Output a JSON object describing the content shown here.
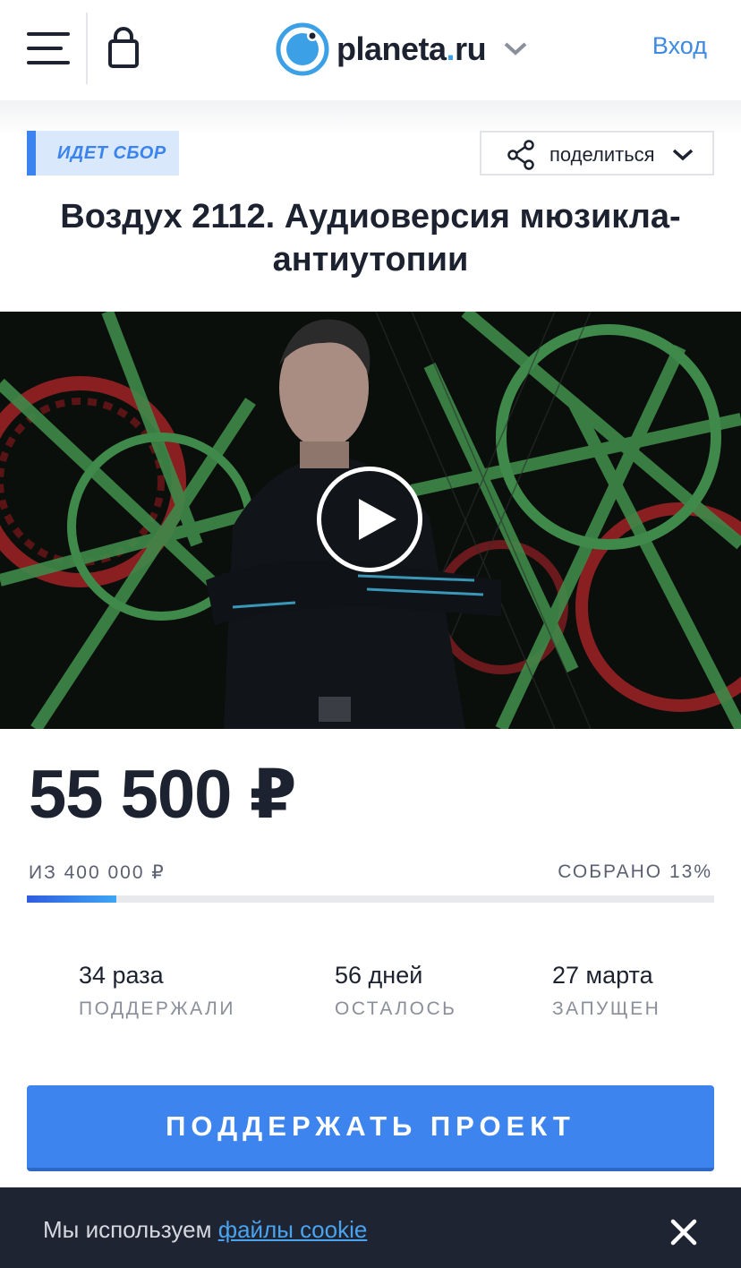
{
  "header": {
    "logo_text_main": "planeta",
    "logo_text_dot": ".",
    "logo_text_tld": "ru",
    "login_label": "Вход"
  },
  "project": {
    "status": "ИДЕТ СБОР",
    "share_label": "поделиться",
    "title": "Воздух 2112. Аудиоверсия мюзикла-антиутопии"
  },
  "funding": {
    "amount": "55 500 ₽",
    "goal": "ИЗ 400 000 ₽",
    "collected": "СОБРАНО 13%",
    "progress_percent": 13
  },
  "stats": [
    {
      "value": "34 раза",
      "caption": "ПОДДЕРЖАЛИ"
    },
    {
      "value": "56 дней",
      "caption": "ОСТАЛОСЬ"
    },
    {
      "value": "27 марта",
      "caption": "ЗАПУЩЕН"
    }
  ],
  "support_button": "ПОДДЕРЖАТЬ ПРОЕКТ",
  "cookie": {
    "text": "Мы используем ",
    "link": "файлы cookie"
  },
  "colors": {
    "accent": "#3d84ef",
    "brand_blue": "#3ca0e6",
    "banner_bg": "#1f2433"
  }
}
